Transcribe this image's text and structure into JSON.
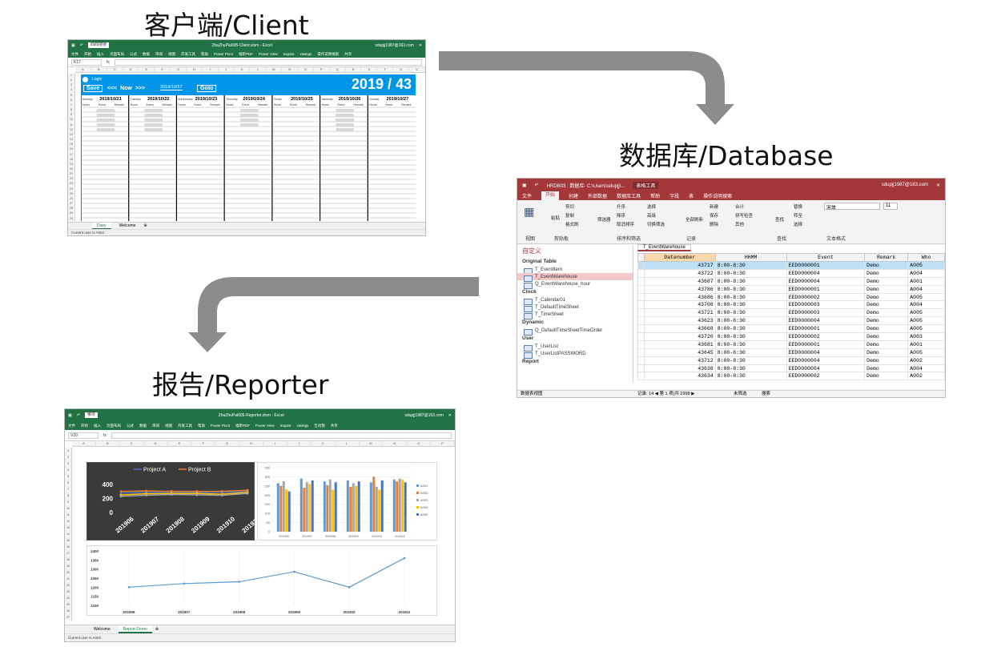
{
  "headings": {
    "client": "客户端/Client",
    "database": "数据库/Database",
    "reporter": "报告/Reporter"
  },
  "colors": {
    "arrow": "#8c8c8c",
    "excel_green": "#217346",
    "access_red": "#a4373a",
    "calendar_blue": "#0095e8"
  },
  "client": {
    "window_title": "ZhaZhuPai005-Client.xlsm - Excel",
    "search_text": "四四搜搜",
    "account": "sdupjj1987@163.com",
    "menu": [
      "文件",
      "开始",
      "插入",
      "页面布局",
      "公式",
      "数据",
      "审阅",
      "视图",
      "开发工具",
      "帮助",
      "Power Pivot",
      "福昕PDF",
      "Power View",
      "Inquire",
      "xlwings",
      "操作说明搜索",
      "共享"
    ],
    "name_box": "K17",
    "login_label": "Login",
    "save_label": "Save",
    "now_label": "<<<  Now  >>>",
    "date_value": "2019/10/27",
    "goto_label": "Goto",
    "week_title": "2019 / 43",
    "days": [
      {
        "weekday": "Monday",
        "date": "2019/10/21"
      },
      {
        "weekday": "Tuesday",
        "date": "2019/10/22"
      },
      {
        "weekday": "Wednesday",
        "date": "2019/10/23"
      },
      {
        "weekday": "Thursday",
        "date": "2019/10/24"
      },
      {
        "weekday": "Friday",
        "date": "2019/10/25"
      },
      {
        "weekday": "Saturday",
        "date": "2019/10/26"
      },
      {
        "weekday": "Sunday",
        "date": "2019/10/27"
      }
    ],
    "subheaders": [
      "Hours",
      "Event",
      "Remark"
    ],
    "sheet_tabs": [
      "Diary",
      "Welcome"
    ],
    "active_tab": "Diary",
    "status": "Current user is A004 ."
  },
  "database": {
    "window_title": "HRDB03 : 数据库- C:\\Users\\sdupjj\\...",
    "context_tab": "表格工具",
    "account": "sdupjj1987@163.com",
    "menu": [
      "文件",
      "开始",
      "创建",
      "外部数据",
      "数据库工具",
      "帮助",
      "字段",
      "表",
      "操作说明搜索"
    ],
    "ribbon_groups": [
      "视图",
      "剪贴板",
      "排序和筛选",
      "记录",
      "查找",
      "文本格式"
    ],
    "ribbon_items": [
      "剪切",
      "复制",
      "格式刷",
      "粘贴",
      "筛选器",
      "升序",
      "降序",
      "取消排序",
      "选择",
      "高级",
      "切换筛选",
      "全部刷新",
      "新建",
      "保存",
      "删除",
      "合计",
      "拼写检查",
      "其他",
      "查找",
      "替换",
      "转至",
      "选择"
    ],
    "font_name": "宋体",
    "font_size": "11",
    "nav_title": "自定义",
    "nav_groups": [
      {
        "name": "Original Table",
        "items": [
          "T_EventItem",
          "T_EventWarehouse",
          "Q_EventWarehouse_hour"
        ]
      },
      {
        "name": "Clock",
        "items": [
          "T_Calendar01",
          "T_DefaultTimeSheet",
          "T_TimeSheet"
        ]
      },
      {
        "name": "Dynamic",
        "items": [
          "Q_DefaultTimeSheetTimeOrder"
        ]
      },
      {
        "name": "User",
        "items": [
          "T_UserList",
          "T_UserListPASSWORD"
        ]
      },
      {
        "name": "Report",
        "items": []
      }
    ],
    "selected_item": "T_EventWarehouse",
    "table_tab": "T_EventWarehouse",
    "columns": [
      "Datenumber",
      "HHMM",
      "Event",
      "Remark",
      "Who"
    ],
    "rows": [
      [
        "43717",
        "8:00-8:30",
        "EED0000001",
        "Demo",
        "A005"
      ],
      [
        "43722",
        "8:00-8:30",
        "EED0000004",
        "Demo",
        "A004"
      ],
      [
        "43687",
        "8:00-8:30",
        "EED0000004",
        "Demo",
        "A001"
      ],
      [
        "43786",
        "8:00-8:30",
        "EED0000001",
        "Demo",
        "A004"
      ],
      [
        "43686",
        "8:00-8:30",
        "EED0000002",
        "Demo",
        "A005"
      ],
      [
        "43708",
        "8:00-8:30",
        "EED0000003",
        "Demo",
        "A004"
      ],
      [
        "43721",
        "8:00-8:30",
        "EED0000003",
        "Demo",
        "A005"
      ],
      [
        "43623",
        "8:00-8:30",
        "EED0000004",
        "Demo",
        "A005"
      ],
      [
        "43668",
        "8:00-8:30",
        "EED0000001",
        "Demo",
        "A005"
      ],
      [
        "43720",
        "8:00-8:30",
        "EED0000002",
        "Demo",
        "A003"
      ],
      [
        "43681",
        "8:00-8:30",
        "EED0000001",
        "Demo",
        "A001"
      ],
      [
        "43645",
        "8:00-8:30",
        "EED0000004",
        "Demo",
        "A005"
      ],
      [
        "43712",
        "8:00-8:30",
        "EED0000004",
        "Demo",
        "A002"
      ],
      [
        "43638",
        "8:00-8:30",
        "EED0000004",
        "Demo",
        "A004"
      ],
      [
        "43634",
        "8:00-8:30",
        "EED0000002",
        "Demo",
        "A002"
      ]
    ],
    "record_nav": "记录: 14 ◀ 第 1 项(共 2998 ▶",
    "filter_label": "未筛选",
    "search_label": "搜索",
    "status": "数据表视图"
  },
  "reporter": {
    "window_title": "ZhaZhuPai005-Reporter.xlsm - Excel",
    "search_text": "哪项",
    "account": "sdupjj1987@163.com",
    "menu": [
      "文件",
      "开始",
      "插入",
      "页面布局",
      "公式",
      "数据",
      "审阅",
      "视图",
      "开发工具",
      "帮助",
      "Power Pivot",
      "福昕PDF",
      "Power View",
      "Inquire",
      "xlwings",
      "告诉我",
      "共享"
    ],
    "name_box": "V20",
    "columns": [
      "A",
      "B",
      "C",
      "D",
      "E",
      "F",
      "G",
      "H",
      "I",
      "J",
      "K",
      "L",
      "M",
      "N",
      "O",
      "P"
    ],
    "sheet_tabs": [
      "Welcome",
      "Report-Demo"
    ],
    "active_tab": "Report-Demo",
    "status": "Current user is A003 ."
  },
  "chart_data": [
    {
      "type": "line",
      "title": "",
      "categories": [
        "201906",
        "201907",
        "201908",
        "201909",
        "201910",
        "201911"
      ],
      "series": [
        {
          "name": "Project A",
          "values": [
            275,
            285,
            280,
            285,
            285,
            295
          ]
        },
        {
          "name": "Project B",
          "values": [
            300,
            305,
            300,
            300,
            300,
            315
          ]
        },
        {
          "name": "",
          "values": [
            250,
            265,
            270,
            270,
            260,
            285
          ]
        },
        {
          "name": "",
          "values": [
            230,
            245,
            255,
            250,
            245,
            270
          ]
        }
      ],
      "y_ticks": [
        0,
        200,
        400
      ],
      "ylim": [
        0,
        500
      ],
      "legend": "top",
      "background": "dark"
    },
    {
      "type": "bar",
      "title": "",
      "categories": [
        "201906",
        "201907",
        "201908",
        "201909",
        "201910",
        "201911"
      ],
      "series": [
        {
          "name": "A001",
          "values": [
            265,
            290,
            275,
            280,
            270,
            285
          ]
        },
        {
          "name": "A002",
          "values": [
            250,
            240,
            255,
            245,
            300,
            275
          ]
        },
        {
          "name": "A003",
          "values": [
            275,
            270,
            285,
            265,
            245,
            290
          ]
        },
        {
          "name": "A004",
          "values": [
            230,
            260,
            230,
            250,
            230,
            285
          ]
        },
        {
          "name": "A005",
          "values": [
            220,
            280,
            270,
            275,
            280,
            270
          ]
        }
      ],
      "y_ticks": [
        0,
        50,
        100,
        150,
        200,
        250,
        300,
        350
      ],
      "ylim": [
        0,
        350
      ],
      "legend": "right"
    },
    {
      "type": "line",
      "title": "",
      "categories": [
        "201906",
        "201907",
        "201908",
        "201909",
        "201910",
        "201911"
      ],
      "series": [
        {
          "name": "",
          "values": [
            1200,
            1220,
            1230,
            1285,
            1200,
            1360
          ]
        }
      ],
      "y_ticks": [
        1100,
        1150,
        1200,
        1250,
        1300,
        1350,
        1400
      ],
      "ylim": [
        1100,
        1400
      ],
      "legend": "none"
    }
  ]
}
